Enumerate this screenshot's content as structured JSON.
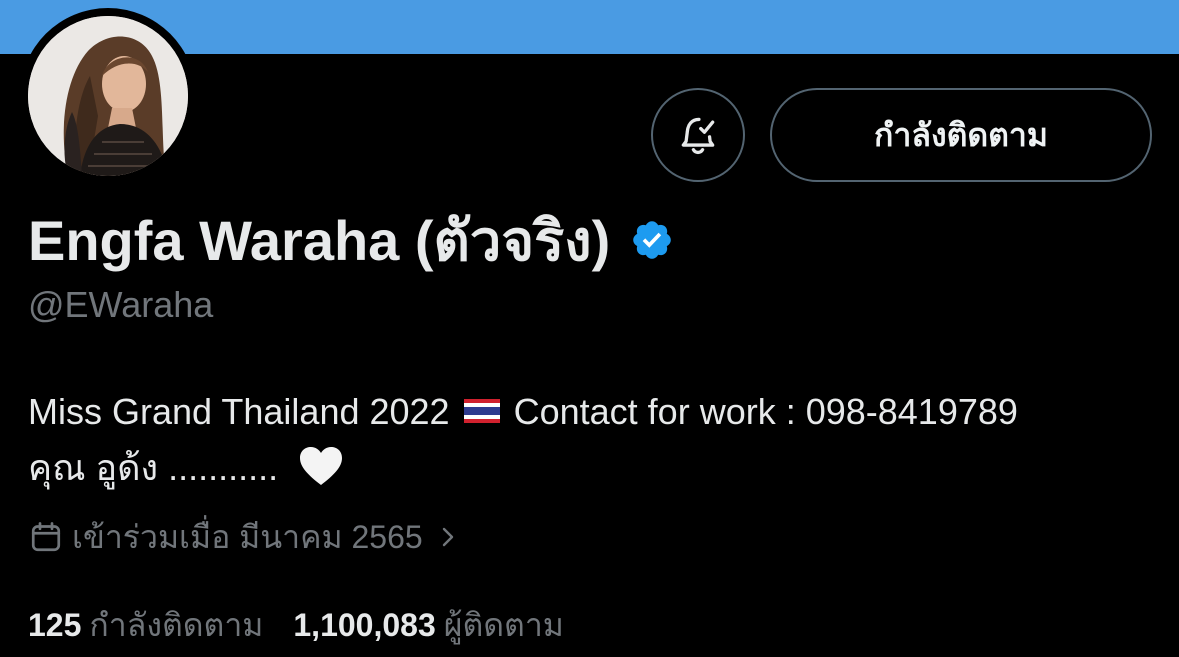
{
  "profile": {
    "display_name": "Engfa Waraha (ตัวจริง)",
    "handle": "@EWaraha",
    "verified": true,
    "bio_line1_part1": "Miss Grand Thailand 2022",
    "bio_line1_part2": "Contact for work : 098-8419789",
    "bio_line2": "คุณ อูด้ง ...........",
    "bio_emoji": [
      "thailand-flag",
      "white-heart"
    ],
    "joined": "เข้าร่วมเมื่อ มีนาคม 2565"
  },
  "actions": {
    "follow_label": "กำลังติดตาม",
    "notify_icon": "bell-check-icon"
  },
  "stats": {
    "following_count": "125",
    "following_label": "กำลังติดตาม",
    "followers_count": "1,100,083",
    "followers_label": "ผู้ติดตาม"
  },
  "colors": {
    "banner": "#4a9be3",
    "background": "#000000",
    "verified": "#1d9bf0",
    "muted_text": "#71767b"
  }
}
